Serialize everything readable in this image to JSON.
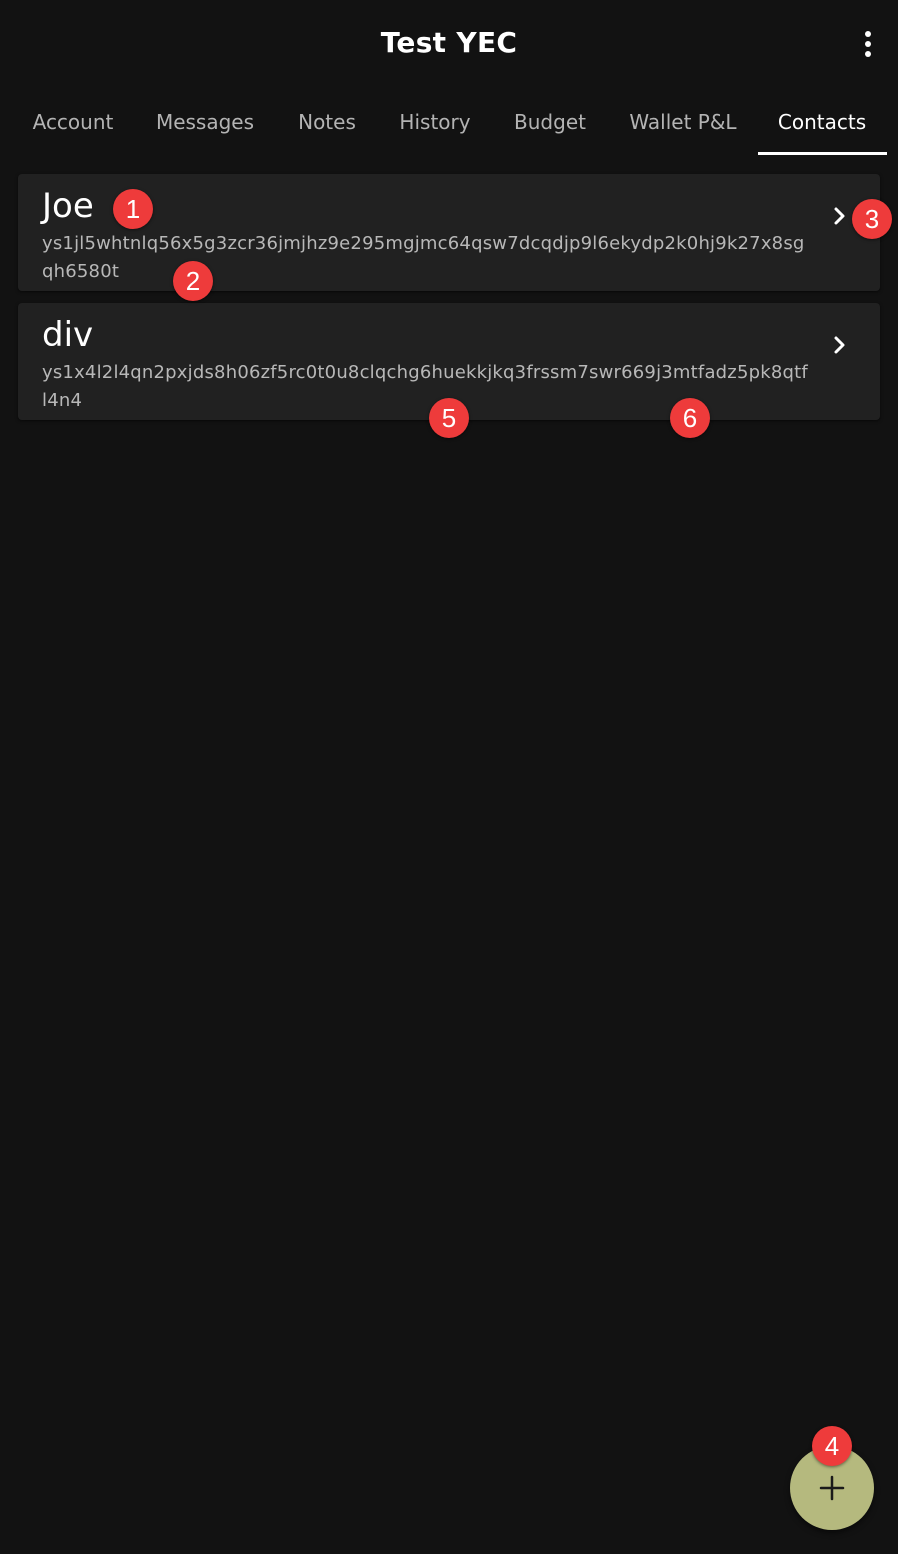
{
  "app_bar": {
    "title": "Test YEC",
    "menu_icon": "more-vert-icon"
  },
  "tabs": [
    {
      "label": "Account",
      "active": false
    },
    {
      "label": "Messages",
      "active": false
    },
    {
      "label": "Notes",
      "active": false
    },
    {
      "label": "History",
      "active": false
    },
    {
      "label": "Budget",
      "active": false
    },
    {
      "label": "Wallet P&L",
      "active": false
    },
    {
      "label": "Contacts",
      "active": true
    }
  ],
  "contacts": [
    {
      "name": "Joe",
      "address": "ys1jl5whtnlq56x5g3zcr36jmjhz9e295mgjmc64qsw7dcqdjp9l6ekydp2k0hj9k27x8sgqh6580t",
      "icon": "chevron-right-icon"
    },
    {
      "name": "div",
      "address": "ys1x4l2l4qn2pxjds8h06zf5rc0t0u8clqchg6huekkjkq3frssm7swr669j3mtfadz5pk8qtfl4n4",
      "icon": "chevron-right-icon"
    }
  ],
  "fab": {
    "icon": "add-icon"
  },
  "markers": [
    "1",
    "2",
    "3",
    "4",
    "5",
    "6"
  ],
  "colors": {
    "background": "#121212",
    "card": "#212121",
    "fab": "#b5b97e",
    "marker": "#ee3b3b"
  }
}
